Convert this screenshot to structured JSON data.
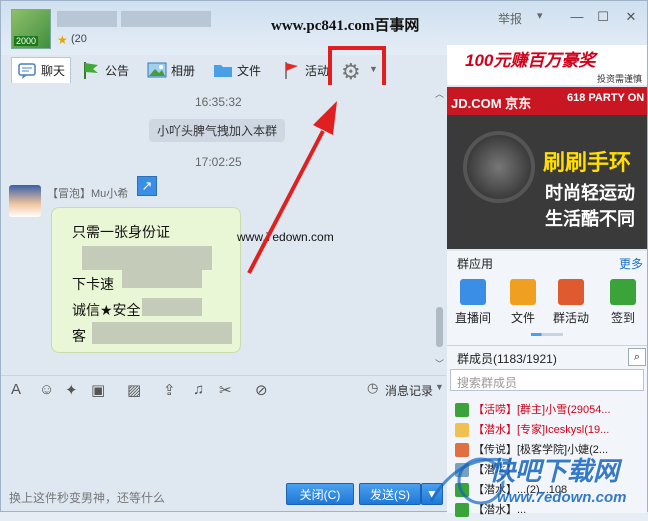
{
  "title": {
    "group_id_partial": "(20",
    "watermark": "www.pc841.com百事网",
    "report_label": "举报",
    "avatar_tag": "2000"
  },
  "toolbar": {
    "items": [
      {
        "label": "聊天",
        "icon": "chat-icon"
      },
      {
        "label": "公告",
        "icon": "flag-icon"
      },
      {
        "label": "相册",
        "icon": "photo-icon"
      },
      {
        "label": "文件",
        "icon": "folder-icon"
      },
      {
        "label": "活动",
        "icon": "red-flag-icon"
      }
    ],
    "settings_icon": "gear-icon"
  },
  "chat": {
    "time1": "16:35:32",
    "system_message": "小吖头脾气拽加入本群",
    "time2": "17:02:25",
    "sender_nick": "【冒泡】Mu小希",
    "message_lines": [
      "只需一张身份证",
      "下卡速",
      "诚信★安全",
      "客"
    ],
    "watermark": "www.7edown.com"
  },
  "input_toolbar": {
    "history_label": "消息记录"
  },
  "bottom": {
    "hint": "换上这件秒变男神，还等什么",
    "close_label": "关闭(C)",
    "send_label": "发送(S)"
  },
  "ads": {
    "top_text": "100元赚百万豪奖",
    "top_small": "投资需谨慎",
    "jd_text": "JD.COM 京东",
    "party_text": "618 PARTY ON",
    "line1": "刷刷手环",
    "line2": "时尚轻运动",
    "line3": "生活酷不同"
  },
  "apps": {
    "title": "群应用",
    "more": "更多",
    "items": [
      {
        "label": "直播间",
        "color": "#3a8ee6"
      },
      {
        "label": "文件",
        "color": "#f0a020"
      },
      {
        "label": "群活动",
        "color": "#e05a30"
      },
      {
        "label": "签到",
        "color": "#3aa33a"
      }
    ]
  },
  "members": {
    "title": "群成员(1183/1921)",
    "search_placeholder": "搜索群成员",
    "rows": [
      {
        "text": "【活唠】[群主]小雪(29054...",
        "color": "#d0021b"
      },
      {
        "text": "【潜水】[专家]Iceskysl(19...",
        "color": "#d0021b"
      },
      {
        "text": "【传说】[极客学院]小婕(2...",
        "color": "#222"
      },
      {
        "text": "【潜水】...",
        "color": "#222"
      },
      {
        "text": "【潜水】...(2)...108",
        "color": "#222"
      },
      {
        "text": "【潜水】...",
        "color": "#222"
      }
    ]
  },
  "watermark_logo": {
    "text": "快吧下载网",
    "url": "www.7edown.com"
  }
}
